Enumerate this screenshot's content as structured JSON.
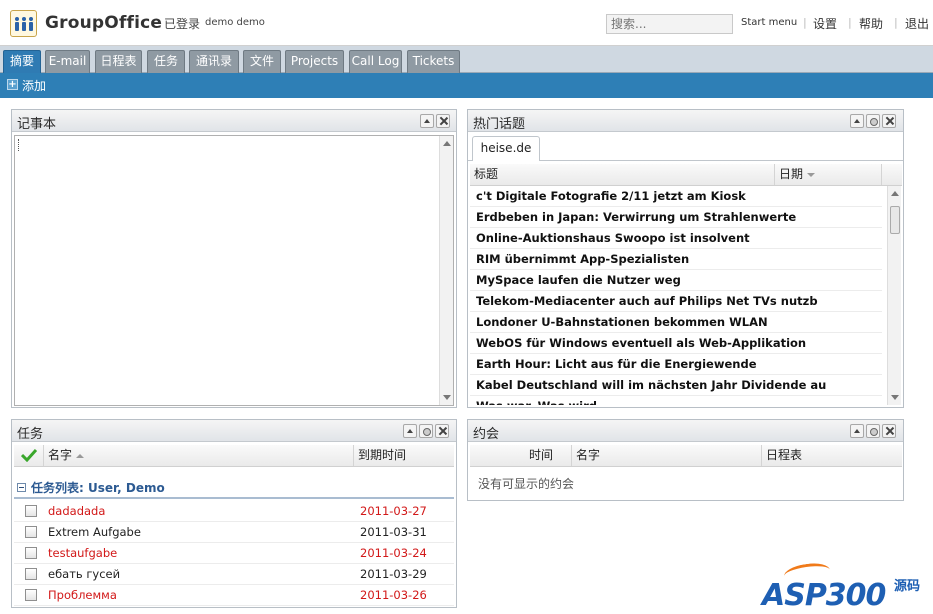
{
  "header": {
    "app_name": "GroupOffice",
    "logged_in_label": "已登录",
    "user_name": "demo demo",
    "search_placeholder": "搜索...",
    "start_menu": "Start menu",
    "settings": "设置",
    "help": "帮助",
    "logout": "退出"
  },
  "tabs": [
    {
      "label": "摘要",
      "active": true
    },
    {
      "label": "E-mail"
    },
    {
      "label": "日程表"
    },
    {
      "label": "任务"
    },
    {
      "label": "通讯录"
    },
    {
      "label": "文件"
    },
    {
      "label": "Projects"
    },
    {
      "label": "Call Log"
    },
    {
      "label": "Tickets"
    }
  ],
  "toolbar": {
    "add_label": "添加"
  },
  "notes": {
    "title": "记事本"
  },
  "rss": {
    "title": "热门话题",
    "feed_tab": "heise.de",
    "col_title": "标题",
    "col_date": "日期",
    "items": [
      "c't Digitale Fotografie 2/11 jetzt am Kiosk",
      "Erdbeben in Japan: Verwirrung um Strahlenwerte",
      "Online-Auktionshaus Swoopo ist insolvent",
      "RIM übernimmt App-Spezialisten",
      "MySpace laufen die Nutzer weg",
      "Telekom-Mediacenter auch auf Philips Net TVs nutzb",
      "Londoner U-Bahnstationen bekommen WLAN",
      "WebOS für Windows eventuell als Web-Applikation",
      "Earth Hour: Licht aus für die Energiewende",
      "Kabel Deutschland will im nächsten Jahr Dividende au",
      "Was war. Was wird."
    ]
  },
  "tasks": {
    "title": "任务",
    "col_name": "名字",
    "col_due": "到期时间",
    "group_label": "任务列表: User, Demo",
    "items": [
      {
        "name": "dadadada",
        "due": "2011-03-27",
        "late": true
      },
      {
        "name": "Extrem Aufgabe",
        "due": "2011-03-31",
        "late": false
      },
      {
        "name": "testaufgabe",
        "due": "2011-03-24",
        "late": true
      },
      {
        "name": "ебать гусей",
        "due": "2011-03-29",
        "late": false
      },
      {
        "name": "Проблемма",
        "due": "2011-03-26",
        "late": true
      }
    ]
  },
  "appointments": {
    "title": "约会",
    "col_time": "时间",
    "col_name": "名字",
    "col_calendar": "日程表",
    "empty_text": "没有可显示的约会"
  },
  "watermark": {
    "brand": "ASP300",
    "suffix": "源码"
  },
  "colors": {
    "accent": "#2e7fb6",
    "late": "#d21818",
    "group": "#2c5a92"
  }
}
